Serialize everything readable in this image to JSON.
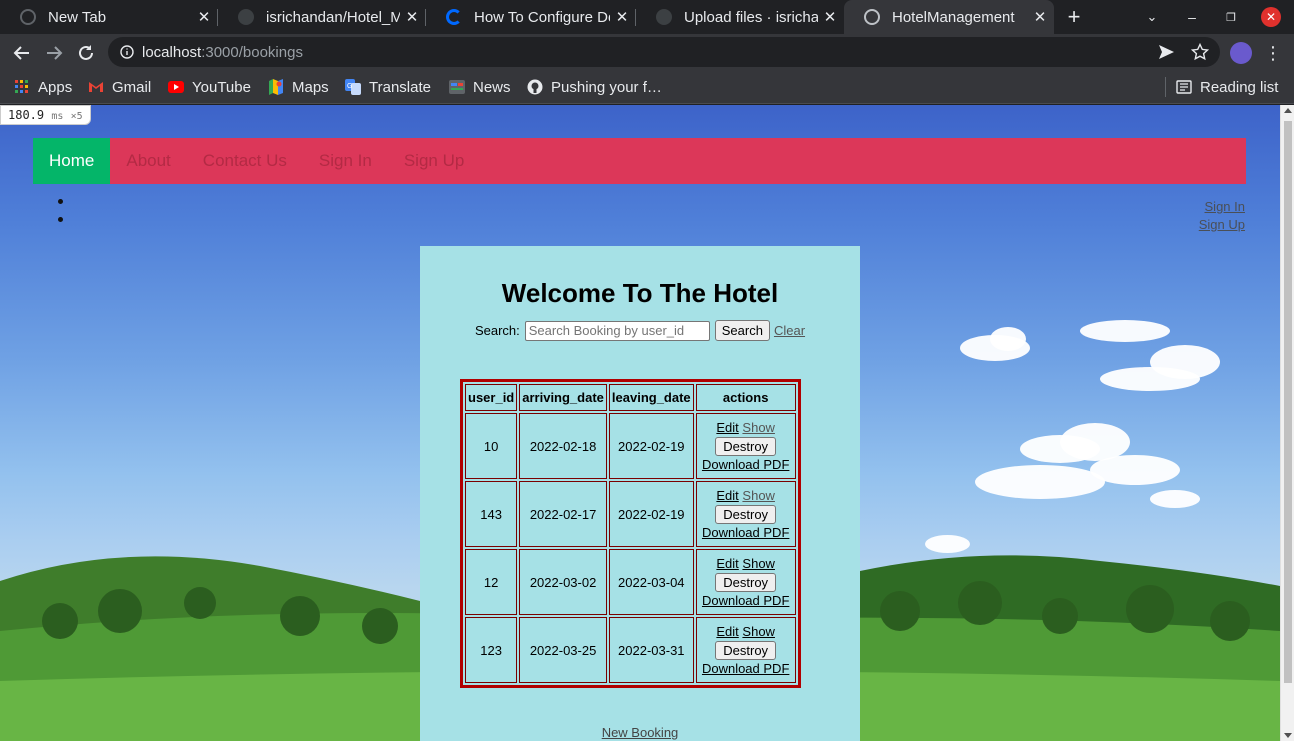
{
  "browser": {
    "tabs": [
      {
        "title": "New Tab",
        "active": false
      },
      {
        "title": "isrichandan/Hotel_M",
        "active": false
      },
      {
        "title": "How To Configure De",
        "active": false
      },
      {
        "title": "Upload files · isrichan",
        "active": false
      },
      {
        "title": "HotelManagement",
        "active": true
      }
    ],
    "url_host": "localhost",
    "url_path": ":3000/bookings",
    "bookmarks": [
      "Apps",
      "Gmail",
      "YouTube",
      "Maps",
      "Translate",
      "News",
      "Pushing your f…"
    ],
    "reading_list": "Reading list"
  },
  "perf": {
    "value": "180.9",
    "unit": "ms",
    "count": "×5"
  },
  "nav": {
    "home": "Home",
    "about": "About",
    "contact": "Contact Us",
    "signin": "Sign In",
    "signup": "Sign Up"
  },
  "top_right": {
    "signin": "Sign In",
    "signup": "Sign Up"
  },
  "main": {
    "title": "Welcome To The Hotel",
    "search_label": "Search:",
    "search_placeholder": "Search Booking by user_id",
    "search_button": "Search",
    "clear_link": "Clear",
    "new_booking": "New Booking"
  },
  "table": {
    "headers": [
      "user_id",
      "arriving_date",
      "leaving_date",
      "actions"
    ],
    "rows": [
      {
        "user_id": "10",
        "arriving": "2022-02-18",
        "leaving": "2022-02-19"
      },
      {
        "user_id": "143",
        "arriving": "2022-02-17",
        "leaving": "2022-02-19"
      },
      {
        "user_id": "12",
        "arriving": "2022-03-02",
        "leaving": "2022-03-04"
      },
      {
        "user_id": "123",
        "arriving": "2022-03-25",
        "leaving": "2022-03-31"
      }
    ],
    "actions": {
      "edit": "Edit",
      "show": "Show",
      "destroy": "Destroy",
      "pdf": "Download PDF"
    }
  },
  "colors": {
    "navbar": "#dc3759",
    "home_active": "#04b569",
    "panel": "#a6e1e6",
    "table_border": "#b10000"
  }
}
